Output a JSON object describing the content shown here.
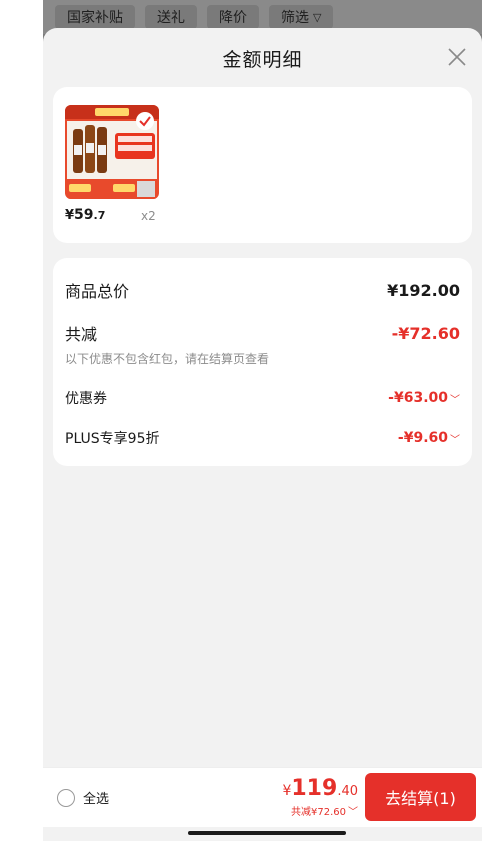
{
  "filter_bar": {
    "items": [
      "国家补贴",
      "送礼",
      "降价",
      "筛选"
    ]
  },
  "sheet": {
    "title": "金额明细",
    "close_icon": "close-icon"
  },
  "product": {
    "price_currency": "¥",
    "price_int": "59",
    "price_dec": ".7",
    "quantity": "x2"
  },
  "summary": {
    "total_label": "商品总价",
    "total_value": "¥192.00",
    "discount_label": "共减",
    "discount_value": "-¥72.60",
    "discount_note": "以下优惠不包含红包，请在结算页查看",
    "coupon_label": "优惠券",
    "coupon_value": "-¥63.00",
    "plus_label": "PLUS专享95折",
    "plus_value": "-¥9.60"
  },
  "bottom_bar": {
    "select_all_label": "全选",
    "total_currency": "¥",
    "total_int": "119",
    "total_dec": ".40",
    "saved_text": "共减¥72.60",
    "checkout_label": "去结算(1)"
  },
  "colors": {
    "accent": "#e5302a",
    "sheet_bg": "#f2f2f2",
    "card_bg": "#ffffff"
  }
}
